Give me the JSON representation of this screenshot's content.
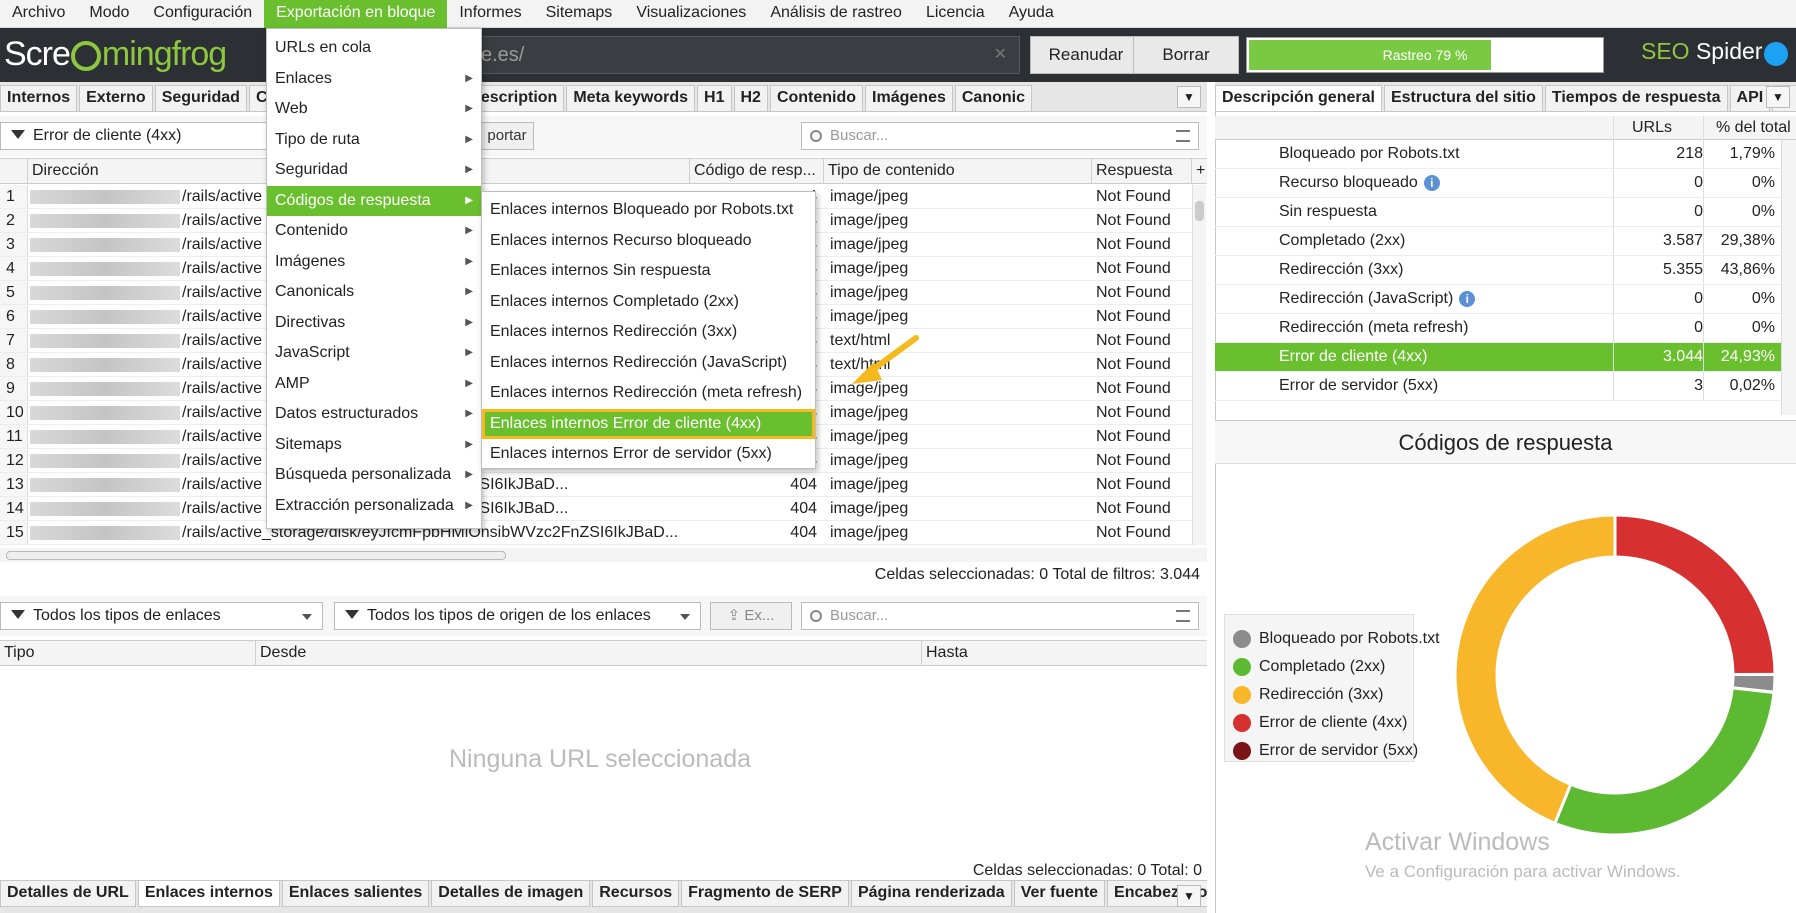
{
  "menubar": [
    "Archivo",
    "Modo",
    "Configuración",
    "Exportación en bloque",
    "Informes",
    "Sitemaps",
    "Visualizaciones",
    "Análisis de rastreo",
    "Licencia",
    "Ayuda"
  ],
  "header": {
    "logo": {
      "part1": "Scre",
      "part2": "mingfrog"
    },
    "url_value": "e.es/",
    "resume": "Reanudar",
    "clear": "Borrar",
    "progress_text": "Rastreo 79 %",
    "progress_fraction": 0.79,
    "brand_seo": "SEO",
    "brand_spider": " Spider"
  },
  "main_tabs": [
    "Internos",
    "Externo",
    "Seguridad",
    "Cóc",
    "ulos de página",
    "Meta description",
    "Meta keywords",
    "H1",
    "H2",
    "Contenido",
    "Imágenes",
    "Canonic"
  ],
  "filter": {
    "selected": "Error de cliente (4xx)",
    "export": "portar",
    "search_placeholder": "Buscar..."
  },
  "grid": {
    "headers": {
      "addr": "Dirección",
      "code": "Código de resp...",
      "ctype": "Tipo de contenido",
      "resp": "Respuesta"
    },
    "rows": [
      {
        "n": "1",
        "addr_prefix": "https://natufabla.es",
        "addr": "/rails/active",
        "code": "4",
        "ctype": "image/jpeg",
        "resp": "Not Found"
      },
      {
        "n": "2",
        "addr": "/rails/active",
        "code": "4",
        "ctype": "image/jpeg",
        "resp": "Not Found"
      },
      {
        "n": "3",
        "addr": "/rails/active",
        "code": "4",
        "ctype": "image/jpeg",
        "resp": "Not Found"
      },
      {
        "n": "4",
        "addr": "/rails/active",
        "code": "4",
        "ctype": "image/jpeg",
        "resp": "Not Found"
      },
      {
        "n": "5",
        "addr": "/rails/active",
        "code": "4",
        "ctype": "image/jpeg",
        "resp": "Not Found"
      },
      {
        "n": "6",
        "addr": "/rails/active",
        "code": "4",
        "ctype": "image/jpeg",
        "resp": "Not Found"
      },
      {
        "n": "7",
        "addr": "/rails/active",
        "code": "4",
        "ctype": "text/html",
        "resp": "Not Found"
      },
      {
        "n": "8",
        "addr": "/rails/active",
        "code": "4",
        "ctype": "text/html",
        "resp": "Not Found"
      },
      {
        "n": "9",
        "addr": "/rails/active",
        "code": "4",
        "ctype": "image/jpeg",
        "resp": "Not Found"
      },
      {
        "n": "10",
        "addr": "/rails/active",
        "code": "4",
        "ctype": "image/jpeg",
        "resp": "Not Found"
      },
      {
        "n": "11",
        "addr": "/rails/active",
        "code": "4",
        "ctype": "image/jpeg",
        "resp": "Not Found"
      },
      {
        "n": "12",
        "addr": "/rails/active",
        "code": "4",
        "ctype": "image/jpeg",
        "resp": "Not Found"
      },
      {
        "n": "13",
        "addr": "/rails/active",
        "addr_tail": "0nsibWVzc2FnZSI6IkJBaD...",
        "code": "404",
        "ctype": "image/jpeg",
        "resp": "Not Found"
      },
      {
        "n": "14",
        "addr": "/rails/active",
        "addr_tail": "0nsibWVzc2FnZSI6IkJBaD...",
        "code": "404",
        "ctype": "image/jpeg",
        "resp": "Not Found"
      },
      {
        "n": "15",
        "addr_prefix": "https://natufabla.es",
        "addr": "/rails/active_storage/disk/eyJfcmFpbHMiOnsibWVzc2FnZSI6IkJBaD...",
        "code": "404",
        "ctype": "image/jpeg",
        "resp": "Not Found"
      }
    ],
    "status": "Celdas seleccionadas:  0  Total de filtros:  3.044"
  },
  "lower": {
    "filter1": "Todos los tipos de enlaces",
    "filter2": "Todos los tipos de origen de los enlaces",
    "export": "Ex...",
    "search_placeholder": "Buscar...",
    "headers": {
      "type": "Tipo",
      "from": "Desde",
      "to": "Hasta"
    },
    "empty": "Ninguna URL seleccionada",
    "status": "Celdas seleccionadas:  0  Total:  0"
  },
  "bottom_tabs": [
    "Detalles de URL",
    "Enlaces internos",
    "Enlaces salientes",
    "Detalles de imagen",
    "Recursos",
    "Fragmento de SERP",
    "Página renderizada",
    "Ver fuente",
    "Encabezados HT"
  ],
  "bulk_menu": [
    "URLs en cola",
    "Enlaces",
    "Web",
    "Tipo de ruta",
    "Seguridad",
    "Códigos de respuesta",
    "Contenido",
    "Imágenes",
    "Canonicals",
    "Directivas",
    "JavaScript",
    "AMP",
    "Datos estructurados",
    "Sitemaps",
    "Búsqueda personalizada",
    "Extracción personalizada"
  ],
  "submenu": [
    "Enlaces internos Bloqueado por Robots.txt",
    "Enlaces internos Recurso bloqueado",
    "Enlaces internos Sin respuesta",
    "Enlaces internos Completado (2xx)",
    "Enlaces internos Redirección (3xx)",
    "Enlaces internos Redirección (JavaScript)",
    "Enlaces internos Redirección (meta refresh)",
    "Enlaces internos Error de cliente (4xx)",
    "Enlaces internos Error de servidor (5xx)"
  ],
  "right": {
    "tabs": [
      "Descripción general",
      "Estructura del sitio",
      "Tiempos de respuesta",
      "API",
      "C"
    ],
    "col_urls": "URLs",
    "col_pct": "% del total",
    "rows": [
      {
        "label": "Bloqueado por Robots.txt",
        "urls": "218",
        "pct": "1,79%"
      },
      {
        "label": "Recurso bloqueado",
        "urls": "0",
        "pct": "0%",
        "info": true
      },
      {
        "label": "Sin respuesta",
        "urls": "0",
        "pct": "0%"
      },
      {
        "label": "Completado (2xx)",
        "urls": "3.587",
        "pct": "29,38%"
      },
      {
        "label": "Redirección (3xx)",
        "urls": "5.355",
        "pct": "43,86%"
      },
      {
        "label": "Redirección (JavaScript)",
        "urls": "0",
        "pct": "0%",
        "info": true
      },
      {
        "label": "Redirección (meta refresh)",
        "urls": "0",
        "pct": "0%"
      },
      {
        "label": "Error de cliente (4xx)",
        "urls": "3.044",
        "pct": "24,93%"
      },
      {
        "label": "Error de servidor (5xx)",
        "urls": "3",
        "pct": "0,02%"
      }
    ],
    "chart_title": "Códigos de respuesta",
    "legend": [
      "Bloqueado por Robots.txt",
      "Completado (2xx)",
      "Redirección (3xx)",
      "Error de cliente (4xx)",
      "Error de servidor (5xx)"
    ],
    "watermark1": "Activar Windows",
    "watermark2": "Ve a Configuración para activar Windows."
  },
  "colors": {
    "accent": "#6abf2e",
    "robots": "#8c8c8c",
    "ok": "#5db832",
    "redirect": "#f8b62b",
    "client_error": "#d73031",
    "server_error": "#7a1416",
    "highlight_box": "#f5b91e"
  },
  "chart_data": {
    "type": "pie",
    "title": "Códigos de respuesta",
    "categories": [
      "Bloqueado por Robots.txt",
      "Completado (2xx)",
      "Redirección (3xx)",
      "Error de cliente (4xx)",
      "Error de servidor (5xx)"
    ],
    "values": [
      218,
      3587,
      5355,
      3044,
      3
    ],
    "legend_position": "left"
  }
}
